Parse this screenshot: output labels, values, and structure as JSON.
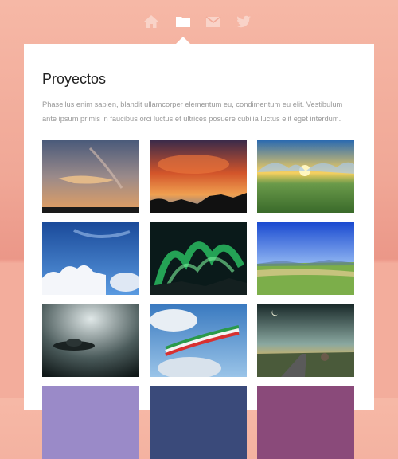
{
  "nav": {
    "items": [
      {
        "icon": "home-icon",
        "active": false
      },
      {
        "icon": "folder-icon",
        "active": true
      },
      {
        "icon": "mail-icon",
        "active": false
      },
      {
        "icon": "twitter-icon",
        "active": false
      }
    ]
  },
  "panel": {
    "title": "Proyectos",
    "description": "Phasellus enim sapien, blandit ullamcorper elementum eu, condimentum eu elit. Vestibulum ante ipsum primis in faucibus orci luctus et ultrices posuere cubilia luctus elit eget interdum."
  },
  "colors": {
    "background_top": "#f6b8a6",
    "background_bottom": "#eb9788",
    "panel": "#ffffff",
    "icon_inactive": "#f9d3c8",
    "icon_active": "#ffffff"
  }
}
